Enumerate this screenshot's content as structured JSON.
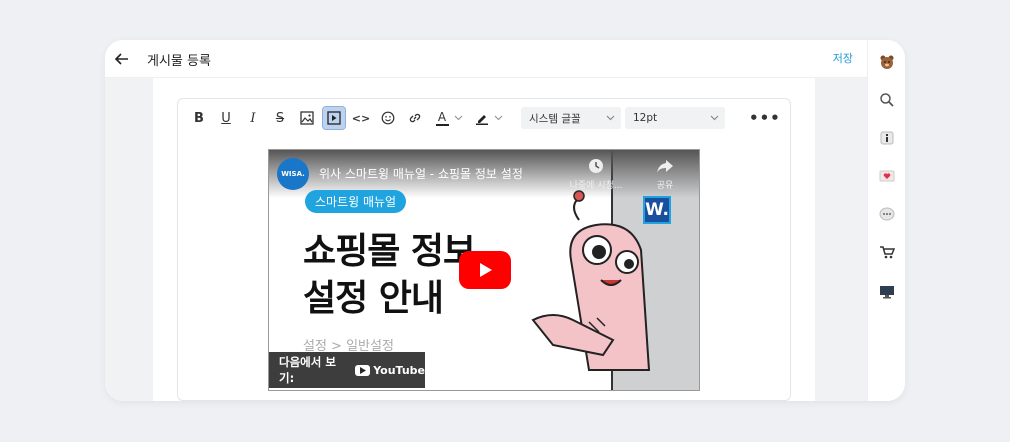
{
  "header": {
    "back_label": "←",
    "title": "게시물 등록",
    "save_label": "저장"
  },
  "toolbar": {
    "bold": "B",
    "underline": "U",
    "italic": "I",
    "strike": "S",
    "code": "<>",
    "more": "•••",
    "font_family": "시스템 글꼴",
    "font_size": "12pt",
    "font_color_glyph": "A"
  },
  "video": {
    "channel_logo": "WISA.",
    "title": "위사 스마트윙 매뉴얼 - 쇼핑몰 정보 설정",
    "watch_later": "나중에 시청...",
    "share": "공유",
    "tag": "스마트윙 매뉴얼",
    "headline_line1": "쇼핑몰 정보",
    "headline_line2": "설정 안내",
    "subtitle": "설정 > 일반설정",
    "watch_on": "다음에서 보기:",
    "youtube": "YouTube",
    "badge": "W."
  },
  "sidebar": {
    "icons": [
      "bear-icon",
      "search-icon",
      "info-icon",
      "heart-mail-icon",
      "chat-icon",
      "cart-icon",
      "monitor-icon"
    ]
  },
  "colors": {
    "accent": "#1e9ad6",
    "play": "#ff0000",
    "tag": "#1fa4e0"
  }
}
